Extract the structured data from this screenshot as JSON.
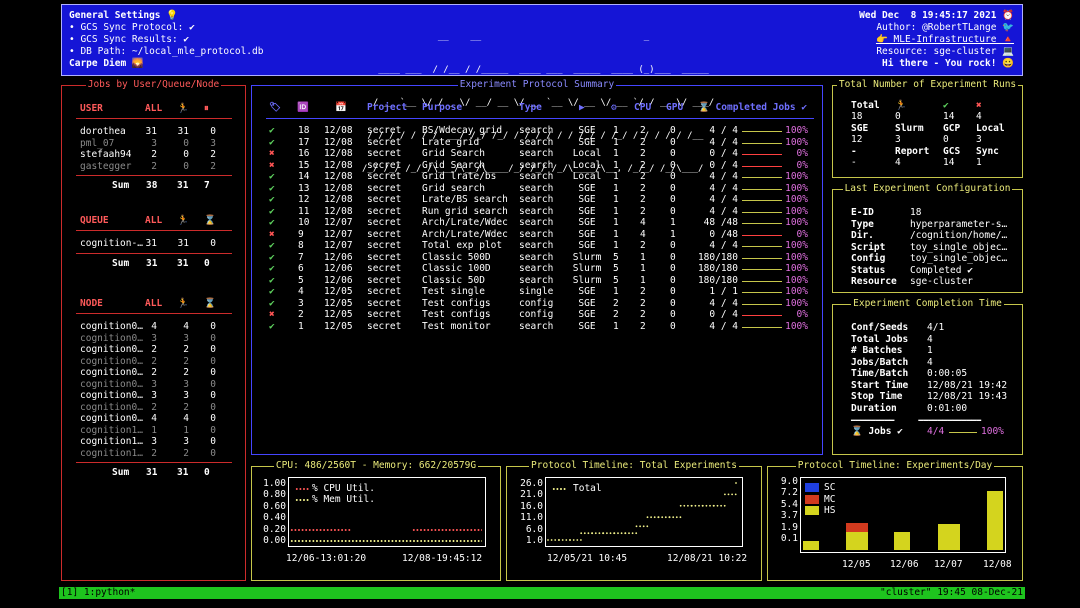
{
  "header": {
    "left": [
      "General Settings 💡",
      "• GCS Sync Protocol: ✔",
      "• GCS Sync Results: ✔",
      "• DB Path: ~/local_mle_protocol.db",
      "Carpe Diem 🌄"
    ],
    "ascii": [
      "              __    __                              _",
      "   ____ ___  / /__ / /_____  ____ ___  _____  ____ (_)___  _____",
      "  / __ `__ \\/ / _ \\/ __/ __ \\/ __ `__ \\/ __ \\/ __ `/ / __ \\/ ___/",
      " / / / / / / /  __/ /_/ /_/ / / / / / / /_/ / /_/ / / / / / /__",
      "/_/ /_/ /_/_/\\___/\\__/\\____/_/ /_/ /_/\\____/\\__, /_/_/ /_/\\___/"
    ],
    "right": [
      "Wed Dec  8 19:45:17 2021 ⏰",
      "Author: @RobertTLange 🐦",
      "👉 MLE-Infrastructure 🔺",
      "Resource: sge-cluster 💻",
      "Hi there - You rock! 😀"
    ]
  },
  "jobs_panel": {
    "title": "Jobs by User/Queue/Node",
    "user_header": [
      "USER",
      "ALL",
      "🏃",
      "⏸"
    ],
    "user_rows": [
      [
        "dorothea",
        "31",
        "31",
        "0"
      ],
      [
        "pml_07",
        "3",
        "0",
        "3"
      ],
      [
        "stefaah94",
        "2",
        "0",
        "2"
      ],
      [
        "gastegger",
        "2",
        "0",
        "2"
      ]
    ],
    "user_sum": [
      "Sum",
      "38",
      "31",
      "7"
    ],
    "queue_header": [
      "QUEUE",
      "ALL",
      "🏃",
      "⌛"
    ],
    "queue_rows": [
      [
        "cognition-…",
        "31",
        "31",
        "0"
      ]
    ],
    "queue_sum": [
      "Sum",
      "31",
      "31",
      "0"
    ],
    "node_header": [
      "NODE",
      "ALL",
      "🏃",
      "⌛"
    ],
    "node_rows": [
      [
        "cognition0…",
        "4",
        "4",
        "0"
      ],
      [
        "cognition0…",
        "3",
        "3",
        "0"
      ],
      [
        "cognition0…",
        "2",
        "2",
        "0"
      ],
      [
        "cognition0…",
        "2",
        "2",
        "0"
      ],
      [
        "cognition0…",
        "2",
        "2",
        "0"
      ],
      [
        "cognition0…",
        "3",
        "3",
        "0"
      ],
      [
        "cognition0…",
        "3",
        "3",
        "0"
      ],
      [
        "cognition0…",
        "2",
        "2",
        "0"
      ],
      [
        "cognition0…",
        "4",
        "4",
        "0"
      ],
      [
        "cognition1…",
        "1",
        "1",
        "0"
      ],
      [
        "cognition1…",
        "3",
        "3",
        "0"
      ],
      [
        "cognition1…",
        "2",
        "2",
        "0"
      ]
    ],
    "node_sum": [
      "Sum",
      "31",
      "31",
      "0"
    ]
  },
  "protocol": {
    "title": "Experiment Protocol Summary",
    "headers": [
      "🏷",
      "🆔",
      "📅",
      "Project",
      "Purpose",
      "Type",
      "▶",
      "⚙",
      "CPU",
      "GPU",
      "⌛ Completed Jobs ✔"
    ],
    "rows": [
      {
        "status": "✔",
        "id": "18",
        "date": "12/08",
        "project": "secret",
        "purpose": "BS/Wdecay grid",
        "type": "search",
        "res": "SGE",
        "seeds": "1",
        "cpu": "2",
        "gpu": "0",
        "jobs": "4 / 4",
        "pct": "100%",
        "frac": 1.0
      },
      {
        "status": "✔",
        "id": "17",
        "date": "12/08",
        "project": "secret",
        "purpose": "Lrate grid",
        "type": "search",
        "res": "SGE",
        "seeds": "1",
        "cpu": "2",
        "gpu": "0",
        "jobs": "4 / 4",
        "pct": "100%",
        "frac": 1.0
      },
      {
        "status": "✖",
        "id": "16",
        "date": "12/08",
        "project": "secret",
        "purpose": "Grid Search",
        "type": "search",
        "res": "Local",
        "seeds": "1",
        "cpu": "2",
        "gpu": "0",
        "jobs": "0 / 4",
        "pct": "0%",
        "frac": 0.0
      },
      {
        "status": "✖",
        "id": "15",
        "date": "12/08",
        "project": "secret",
        "purpose": "Grid Search",
        "type": "search",
        "res": "Local",
        "seeds": "1",
        "cpu": "2",
        "gpu": "0",
        "jobs": "0 / 4",
        "pct": "0%",
        "frac": 0.0
      },
      {
        "status": "✔",
        "id": "14",
        "date": "12/08",
        "project": "secret",
        "purpose": "Grid lrate/bs",
        "type": "search",
        "res": "Local",
        "seeds": "1",
        "cpu": "2",
        "gpu": "0",
        "jobs": "4 / 4",
        "pct": "100%",
        "frac": 1.0
      },
      {
        "status": "✔",
        "id": "13",
        "date": "12/08",
        "project": "secret",
        "purpose": "Grid search",
        "type": "search",
        "res": "SGE",
        "seeds": "1",
        "cpu": "2",
        "gpu": "0",
        "jobs": "4 / 4",
        "pct": "100%",
        "frac": 1.0
      },
      {
        "status": "✔",
        "id": "12",
        "date": "12/08",
        "project": "secret",
        "purpose": "Lrate/BS search",
        "type": "search",
        "res": "SGE",
        "seeds": "1",
        "cpu": "2",
        "gpu": "0",
        "jobs": "4 / 4",
        "pct": "100%",
        "frac": 1.0
      },
      {
        "status": "✔",
        "id": "11",
        "date": "12/08",
        "project": "secret",
        "purpose": "Run grid search",
        "type": "search",
        "res": "SGE",
        "seeds": "1",
        "cpu": "2",
        "gpu": "0",
        "jobs": "4 / 4",
        "pct": "100%",
        "frac": 1.0
      },
      {
        "status": "✔",
        "id": "10",
        "date": "12/07",
        "project": "secret",
        "purpose": "Arch/Lrate/Wdec",
        "type": "search",
        "res": "SGE",
        "seeds": "1",
        "cpu": "4",
        "gpu": "1",
        "jobs": "48 /48",
        "pct": "100%",
        "frac": 1.0
      },
      {
        "status": "✖",
        "id": "9",
        "date": "12/07",
        "project": "secret",
        "purpose": "Arch/Lrate/Wdec",
        "type": "search",
        "res": "SGE",
        "seeds": "1",
        "cpu": "4",
        "gpu": "1",
        "jobs": "0 /48",
        "pct": "0%",
        "frac": 0.0
      },
      {
        "status": "✔",
        "id": "8",
        "date": "12/07",
        "project": "secret",
        "purpose": "Total exp plot",
        "type": "search",
        "res": "SGE",
        "seeds": "1",
        "cpu": "2",
        "gpu": "0",
        "jobs": "4 / 4",
        "pct": "100%",
        "frac": 1.0
      },
      {
        "status": "✔",
        "id": "7",
        "date": "12/06",
        "project": "secret",
        "purpose": "Classic 500D",
        "type": "search",
        "res": "Slurm",
        "seeds": "5",
        "cpu": "1",
        "gpu": "0",
        "jobs": "180/180",
        "pct": "100%",
        "frac": 1.0
      },
      {
        "status": "✔",
        "id": "6",
        "date": "12/06",
        "project": "secret",
        "purpose": "Classic 100D",
        "type": "search",
        "res": "Slurm",
        "seeds": "5",
        "cpu": "1",
        "gpu": "0",
        "jobs": "180/180",
        "pct": "100%",
        "frac": 1.0
      },
      {
        "status": "✔",
        "id": "5",
        "date": "12/06",
        "project": "secret",
        "purpose": "Classic 50D",
        "type": "search",
        "res": "Slurm",
        "seeds": "5",
        "cpu": "1",
        "gpu": "0",
        "jobs": "180/180",
        "pct": "100%",
        "frac": 1.0
      },
      {
        "status": "✔",
        "id": "4",
        "date": "12/05",
        "project": "secret",
        "purpose": "Test single",
        "type": "single",
        "res": "SGE",
        "seeds": "1",
        "cpu": "2",
        "gpu": "0",
        "jobs": "1 / 1",
        "pct": "100%",
        "frac": 1.0
      },
      {
        "status": "✔",
        "id": "3",
        "date": "12/05",
        "project": "secret",
        "purpose": "Test configs",
        "type": "config",
        "res": "SGE",
        "seeds": "2",
        "cpu": "2",
        "gpu": "0",
        "jobs": "4 / 4",
        "pct": "100%",
        "frac": 1.0
      },
      {
        "status": "✖",
        "id": "2",
        "date": "12/05",
        "project": "secret",
        "purpose": "Test configs",
        "type": "config",
        "res": "SGE",
        "seeds": "2",
        "cpu": "2",
        "gpu": "0",
        "jobs": "0 / 4",
        "pct": "0%",
        "frac": 0.0
      },
      {
        "status": "✔",
        "id": "1",
        "date": "12/05",
        "project": "secret",
        "purpose": "Test monitor",
        "type": "search",
        "res": "SGE",
        "seeds": "1",
        "cpu": "2",
        "gpu": "0",
        "jobs": "4 / 4",
        "pct": "100%",
        "frac": 1.0
      }
    ]
  },
  "total_runs": {
    "title": "Total Number of Experiment Runs",
    "row1_labels": [
      "Total",
      "🏃",
      "✔",
      "✖"
    ],
    "row1_values": [
      "18",
      "0",
      "14",
      "4"
    ],
    "row2_labels": [
      "SGE",
      "Slurm",
      "GCP",
      "Local"
    ],
    "row2_values": [
      "12",
      "3",
      "0",
      "3"
    ],
    "row3_labels": [
      "-",
      "Report",
      "GCS",
      "Sync"
    ],
    "row3_values": [
      "-",
      "4",
      "14",
      "1"
    ]
  },
  "last_config": {
    "title": "Last Experiment Configuration",
    "rows": [
      [
        "E-ID",
        "18"
      ],
      [
        "Type",
        "hyperparameter-s…"
      ],
      [
        "Dir.",
        "/cognition/home/…"
      ],
      [
        "Script",
        "toy_single_objec…"
      ],
      [
        "Config",
        "toy_single_objec…"
      ],
      [
        "Status",
        "Completed ✔"
      ],
      [
        "Resource",
        "sge-cluster"
      ]
    ]
  },
  "completion_time": {
    "title": "Experiment Completion Time",
    "rows": [
      [
        "Conf/Seeds",
        "4/1"
      ],
      [
        "Total Jobs",
        "4"
      ],
      [
        "# Batches",
        "1"
      ],
      [
        "Jobs/Batch",
        "4"
      ],
      [
        "Time/Batch",
        "0:00:05"
      ],
      [
        "Start Time",
        "12/08/21 19:42"
      ],
      [
        "Stop Time",
        "12/08/21 19:43"
      ],
      [
        "Duration",
        "0:01:00"
      ]
    ],
    "sep": "━━━━━━━━━     ━━━━━━━━━━━━━",
    "jobs_label": "⌛ Jobs ✔",
    "jobs_value": "4/4",
    "jobs_pct": "100%",
    "jobs_frac": 1.0
  },
  "chart_data": [
    {
      "type": "scatter",
      "title": "CPU: 486/2560T - Memory: 662/20579G",
      "series": [
        {
          "name": "% CPU Util.",
          "color": "#ff5555",
          "y": [
            0.2,
            0.2,
            0.2,
            0.2,
            0.2,
            0.2,
            0.2,
            0.2,
            0.2,
            0.2,
            0.2,
            0.2,
            0.2,
            0.2,
            0.2,
            0.2,
            0.2,
            0.2,
            0.2,
            0.2,
            0.2,
            0.2,
            null,
            null,
            null,
            null,
            null,
            null,
            null,
            null,
            null,
            null,
            null,
            null,
            null,
            null,
            null,
            null,
            null,
            null,
            null,
            null,
            null,
            null,
            null,
            null,
            null,
            null,
            null,
            null,
            null,
            null,
            null,
            null,
            null,
            null,
            null,
            null,
            null,
            null,
            null,
            null,
            null,
            null,
            null,
            null,
            null,
            null,
            null,
            null,
            null,
            null,
            null,
            null,
            null,
            null,
            null,
            null,
            null,
            null,
            null,
            null,
            null,
            null,
            null,
            null,
            null,
            null,
            null,
            null,
            null,
            null,
            null,
            null,
            null,
            null,
            null,
            null,
            null,
            null,
            null,
            null,
            null,
            null,
            null,
            null,
            null,
            null,
            null,
            null,
            null,
            null,
            null,
            null,
            null,
            null,
            0.2,
            0.2,
            0.2,
            0.2,
            0.2,
            0.2,
            0.2,
            0.2,
            0.2,
            0.2,
            0.2,
            0.2,
            0.2,
            0.2,
            0.2,
            0.2,
            0.2,
            0.2,
            0.2,
            0.2,
            0.2,
            0.2
          ]
        },
        {
          "name": "% Mem Util.",
          "color": "#f2f28c",
          "y": "flat-0.0"
        }
      ],
      "yticks": [
        "1.00",
        "0.80",
        "0.60",
        "0.40",
        "0.20",
        "0.00"
      ],
      "ylim": [
        0,
        1
      ],
      "xticks": [
        "12/06-13:01:20",
        "12/08-19:45:12"
      ]
    },
    {
      "type": "scatter",
      "title": "Protocol Timeline: Total Experiments",
      "series": [
        {
          "name": "Total",
          "color": "#f2f28c",
          "x": [
            0,
            1,
            2,
            3,
            4,
            5,
            6,
            7,
            8,
            9,
            10,
            11,
            12,
            13,
            14,
            15,
            16,
            17
          ],
          "y": [
            1,
            1,
            1,
            4,
            4,
            4,
            4,
            4,
            7,
            11,
            11,
            11,
            16,
            16,
            16,
            16,
            21,
            26
          ]
        }
      ],
      "yticks": [
        "26.0",
        "21.0",
        "16.0",
        "11.0",
        "6.0",
        "1.0"
      ],
      "ylim": [
        1,
        26
      ],
      "xticks": [
        "12/05/21 10:45",
        "12/08/21 10:22"
      ]
    },
    {
      "type": "bar",
      "title": "Protocol Timeline: Experiments/Day",
      "categories": [
        "",
        "12/05",
        "12/06",
        "12/07",
        "12/08"
      ],
      "series": [
        {
          "name": "SC",
          "color": "#1f3fdf",
          "values": [
            0,
            0,
            0,
            0,
            0
          ]
        },
        {
          "name": "MC",
          "color": "#d23a1e",
          "values": [
            0,
            1.3,
            0,
            0,
            0
          ]
        },
        {
          "name": "HS",
          "color": "#d4d41e",
          "values": [
            1.3,
            2.6,
            2.6,
            3.8,
            8.5
          ]
        }
      ],
      "yticks": [
        "9.0",
        "7.2",
        "5.4",
        "3.7",
        "1.9",
        "0.1"
      ],
      "ylim": [
        0.1,
        9.0
      ]
    }
  ],
  "statusbar": {
    "left": "[1] 1:python*",
    "right": "\"cluster\" 19:45 08-Dec-21"
  }
}
